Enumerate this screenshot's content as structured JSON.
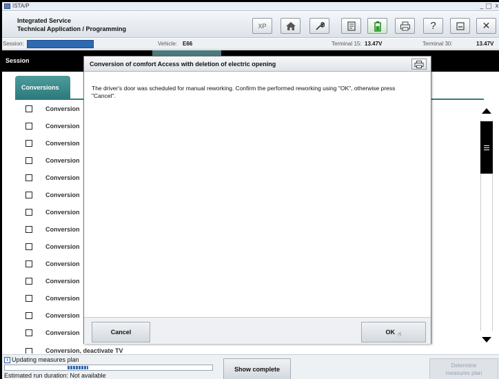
{
  "window": {
    "title": "ISTA/P"
  },
  "header": {
    "brand_line1": "Integrated Service",
    "brand_line2": "Technical Application / Programming",
    "toolbar": [
      {
        "name": "xp-button",
        "label": "XP",
        "icon": "xp-icon"
      },
      {
        "name": "home-button",
        "icon": "home-icon"
      },
      {
        "name": "tools-button",
        "icon": "wrench-icon"
      },
      {
        "name": "vehicle-info-button",
        "icon": "vehicle-info-icon"
      },
      {
        "name": "battery-button",
        "icon": "battery-icon",
        "active": true
      },
      {
        "name": "print-button",
        "icon": "printer-icon"
      },
      {
        "name": "help-button",
        "label": "?",
        "icon": "help-icon"
      },
      {
        "name": "minimize-app-button",
        "icon": "minimize-icon"
      },
      {
        "name": "exit-button",
        "label": "✕",
        "icon": "close-icon"
      }
    ]
  },
  "infobar": {
    "session_label": "Session:",
    "vehicle_label": "Vehicle:",
    "vehicle_value": "E66",
    "terminal15_label": "Terminal 15:",
    "terminal15_value": "13.47V",
    "terminal30_label": "Terminal 30:",
    "terminal30_value": "13.47V"
  },
  "navbar": {
    "label": "Session"
  },
  "tab": {
    "label": "Conversions"
  },
  "list": {
    "item_label": "Conversion",
    "row_count": 14,
    "partial_label": "Conversion, deactivate TV"
  },
  "dialog": {
    "title": "Conversion of comfort Access with deletion of electric opening",
    "message": "The driver's door was scheduled for manual reworking. Confirm the performed reworking using \"OK\", otherwise press \"Cancel\".",
    "cancel_label": "Cancel",
    "ok_label": "OK"
  },
  "status": {
    "text": "Updating measures plan",
    "progress": 0.1,
    "run_duration": "Estimated run duration: Not available",
    "show_complete_label": "Show complete",
    "determine_label_line1": "Determine",
    "determine_label_line2": "measures plan"
  },
  "colors": {
    "tab_teal": "#2e7b7d",
    "session_blue": "#2d6ab3",
    "nav_black": "#000000"
  }
}
